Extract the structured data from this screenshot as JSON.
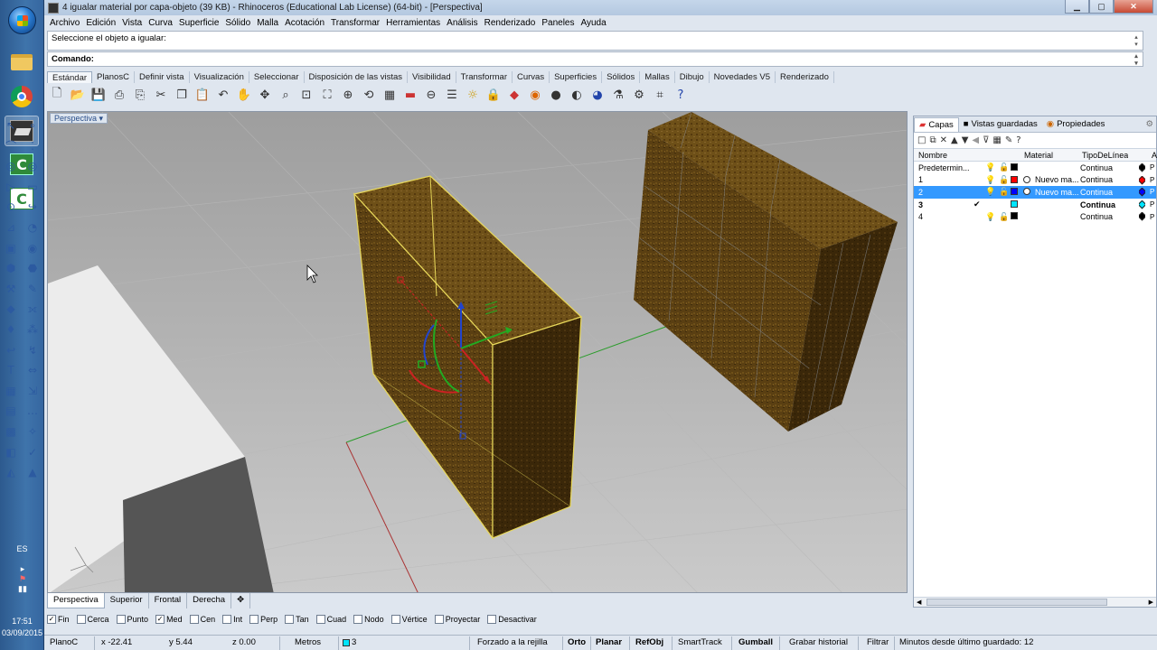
{
  "os": {
    "language": "ES",
    "time": "17:51",
    "date": "03/09/2015"
  },
  "window": {
    "title": "4 igualar material por capa-objeto (39 KB) - Rhinoceros (Educational Lab License) (64-bit) - [Perspectiva]"
  },
  "menu": [
    "Archivo",
    "Edición",
    "Vista",
    "Curva",
    "Superficie",
    "Sólido",
    "Malla",
    "Acotación",
    "Transformar",
    "Herramientas",
    "Análisis",
    "Renderizado",
    "Paneles",
    "Ayuda"
  ],
  "command": {
    "history": "Seleccione el objeto a igualar:",
    "prompt": "Comando:"
  },
  "toolbar_tabs": [
    "Estándar",
    "PlanosC",
    "Definir vista",
    "Visualización",
    "Seleccionar",
    "Disposición de las vistas",
    "Visibilidad",
    "Transformar",
    "Curvas",
    "Superficies",
    "Sólidos",
    "Mallas",
    "Dibujo",
    "Novedades V5",
    "Renderizado"
  ],
  "toolbar_icons": [
    "new-icon",
    "open-icon",
    "save-icon",
    "print-icon",
    "import-icon",
    "cut-icon",
    "copy-icon",
    "paste-icon",
    "undo-icon",
    "pan-icon",
    "move-icon",
    "zoom-icon",
    "zoom-window-icon",
    "zoom-extents-icon",
    "zoom-selected-icon",
    "rotate-view-icon",
    "grid-icon",
    "car-icon",
    "cplane-icon",
    "options-icon",
    "light-icon",
    "lock-icon",
    "render-icon",
    "color-wheel-icon",
    "sphere-icon",
    "shaded-sphere-icon",
    "blue-sphere-icon",
    "filter-icon",
    "gear-icon",
    "crop-icon",
    "help-icon"
  ],
  "viewport": {
    "title": "Perspectiva",
    "tabs": [
      "Perspectiva",
      "Superior",
      "Frontal",
      "Derecha"
    ]
  },
  "panel": {
    "tabs": [
      "Capas",
      "Vistas guardadas",
      "Propiedades"
    ],
    "columns": {
      "name": "Nombre",
      "material": "Material",
      "linetype": "TipoDeLínea",
      "extra": "A"
    },
    "layers": [
      {
        "name": "Predetermin...",
        "material": "",
        "linetype": "Continua",
        "color": "#000000",
        "diamond": "#000000",
        "current": false,
        "selected": false
      },
      {
        "name": "1",
        "material": "Nuevo ma...",
        "linetype": "Continua",
        "color": "#ff0000",
        "diamond": "#ff0000",
        "current": false,
        "selected": false
      },
      {
        "name": "2",
        "material": "Nuevo ma...",
        "linetype": "Continua",
        "color": "#0000ff",
        "diamond": "#0000ff",
        "current": false,
        "selected": true
      },
      {
        "name": "3",
        "material": "",
        "linetype": "Continua",
        "color": "#00e5ff",
        "diamond": "#00e5ff",
        "current": true,
        "selected": false
      },
      {
        "name": "4",
        "material": "",
        "linetype": "Continua",
        "color": "#000000",
        "diamond": "#000000",
        "current": false,
        "selected": false
      }
    ]
  },
  "osnaps": [
    {
      "label": "Fin",
      "checked": true
    },
    {
      "label": "Cerca",
      "checked": false
    },
    {
      "label": "Punto",
      "checked": false
    },
    {
      "label": "Med",
      "checked": true
    },
    {
      "label": "Cen",
      "checked": false
    },
    {
      "label": "Int",
      "checked": false
    },
    {
      "label": "Perp",
      "checked": false
    },
    {
      "label": "Tan",
      "checked": false
    },
    {
      "label": "Cuad",
      "checked": false
    },
    {
      "label": "Nodo",
      "checked": false
    },
    {
      "label": "Vértice",
      "checked": false
    },
    {
      "label": "Proyectar",
      "checked": false
    },
    {
      "label": "Desactivar",
      "checked": false
    }
  ],
  "status": {
    "cplane": "PlanoC",
    "x": "x -22.41",
    "y": "y 5.44",
    "z": "z 0.00",
    "units": "Metros",
    "layer": "3",
    "layer_color": "#00e5ff",
    "snap": "Forzado a la rejilla",
    "ortho": "Orto",
    "planar": "Planar",
    "osnap": "RefObj",
    "smarttrack": "SmartTrack",
    "gumball": "Gumball",
    "history": "Grabar historial",
    "filter": "Filtrar",
    "autosave": "Minutos desde último guardado: 12"
  }
}
